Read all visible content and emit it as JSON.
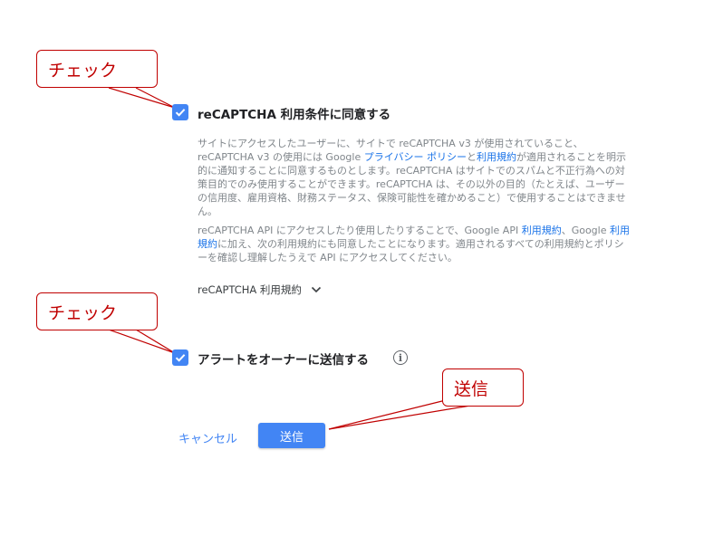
{
  "recaptcha_consent": {
    "label": "reCAPTCHA 利用条件に同意する",
    "checked": true,
    "description_1": {
      "before_link1": "サイトにアクセスしたユーザーに、サイトで reCAPTCHA v3 が使用されていること、reCAPTCHA v3 の使用には Google ",
      "link1": "プライバシー ポリシー",
      "between": "と",
      "link2": "利用規約",
      "after": "が適用されることを明示的に通知することに同意するものとします。reCAPTCHA はサイトでのスパムと不正行為への対策目的でのみ使用することができます。reCAPTCHA は、その以外の目的（たとえば、ユーザーの信用度、雇用資格、財務ステータス、保険可能性を確かめること）で使用することはできません。"
    },
    "description_2": {
      "before_link1": "reCAPTCHA API にアクセスしたり使用したりすることで、Google API ",
      "link1": "利用規約",
      "between": "、Google ",
      "link2": "利用規約",
      "after": "に加え、次の利用規約にも同意したことになります。適用されるすべての利用規約とポリシーを確認し理解したうえで API にアクセスしてください。"
    },
    "terms_toggle": "reCAPTCHA 利用規約"
  },
  "owner_alert": {
    "label": "アラートをオーナーに送信する",
    "checked": true
  },
  "actions": {
    "cancel": "キャンセル",
    "submit": "送信"
  },
  "annotations": {
    "callout_1": "チェック",
    "callout_2": "チェック",
    "callout_3": "送信"
  },
  "colors": {
    "accent": "#4285f4",
    "link": "#1a73e8",
    "annotation": "#c00000"
  }
}
